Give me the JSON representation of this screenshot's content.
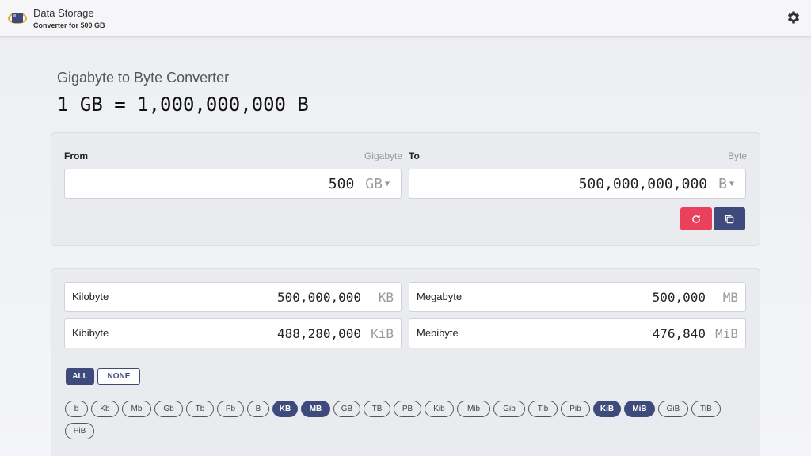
{
  "app": {
    "title": "Data Storage",
    "subtitle": "Converter for 500 GB",
    "settings_icon": "gear-icon"
  },
  "heading": "Gigabyte to Byte Converter",
  "result": "1 GB = 1,000,000,000 B",
  "from": {
    "label": "From",
    "unit_name": "Gigabyte",
    "value": "500",
    "unit": "GB"
  },
  "to": {
    "label": "To",
    "unit_name": "Byte",
    "value": "500,000,000,000",
    "unit": "B"
  },
  "actions": {
    "reset_icon": "refresh-icon",
    "copy_icon": "copy-icon",
    "reset_color": "#e9405b",
    "copy_color": "#3f4a7c"
  },
  "results": [
    {
      "name": "Kilobyte",
      "value": "500,000,000",
      "unit": "KB"
    },
    {
      "name": "Megabyte",
      "value": "500,000",
      "unit": "MB"
    },
    {
      "name": "Kibibyte",
      "value": "488,280,000",
      "unit": "KiB"
    },
    {
      "name": "Mebibyte",
      "value": "476,840",
      "unit": "MiB"
    }
  ],
  "filters": {
    "all_label": "ALL",
    "none_label": "NONE",
    "chips": [
      {
        "label": "b",
        "selected": false
      },
      {
        "label": "Kb",
        "selected": false
      },
      {
        "label": "Mb",
        "selected": false
      },
      {
        "label": "Gb",
        "selected": false
      },
      {
        "label": "Tb",
        "selected": false
      },
      {
        "label": "Pb",
        "selected": false
      },
      {
        "label": "B",
        "selected": false
      },
      {
        "label": "KB",
        "selected": true
      },
      {
        "label": "MB",
        "selected": true
      },
      {
        "label": "GB",
        "selected": false
      },
      {
        "label": "TB",
        "selected": false
      },
      {
        "label": "PB",
        "selected": false
      },
      {
        "label": "Kib",
        "selected": false
      },
      {
        "label": "Mib",
        "selected": false
      },
      {
        "label": "Gib",
        "selected": false
      },
      {
        "label": "Tib",
        "selected": false
      },
      {
        "label": "Pib",
        "selected": false
      },
      {
        "label": "KiB",
        "selected": true
      },
      {
        "label": "MiB",
        "selected": true
      },
      {
        "label": "GiB",
        "selected": false
      },
      {
        "label": "TiB",
        "selected": false
      },
      {
        "label": "PiB",
        "selected": false
      }
    ]
  }
}
